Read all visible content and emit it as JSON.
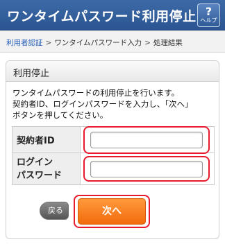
{
  "header": {
    "title": "ワンタイムパスワード利用停止",
    "help_symbol": "?",
    "help_label": "ヘルプ"
  },
  "breadcrumb": {
    "items": [
      "利用者認証",
      "ワンタイムパスワード入力",
      "処理結果"
    ],
    "separator": ">"
  },
  "panel": {
    "title": "利用停止",
    "description_lines": [
      "ワンタイムパスワードの利用停止を行います。",
      "契約者ID、ログインパスワードを入力し、「次へ」",
      "ボタンを押してください。"
    ]
  },
  "form": {
    "contract_id_label": "契約者ID",
    "contract_id_value": "",
    "password_label_line1": "ログイン",
    "password_label_line2": "パスワード",
    "password_value": ""
  },
  "buttons": {
    "back": "戻る",
    "next": "次へ"
  },
  "colors": {
    "header_bg": "#2f5b98",
    "link": "#1e5bb8",
    "next_button": "#f57f1e",
    "highlight": "#e8192c"
  },
  "icons": {
    "help": "question-mark-icon"
  }
}
